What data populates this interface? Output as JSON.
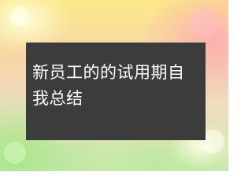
{
  "card": {
    "title": "新员工的的试用期自我总结"
  }
}
